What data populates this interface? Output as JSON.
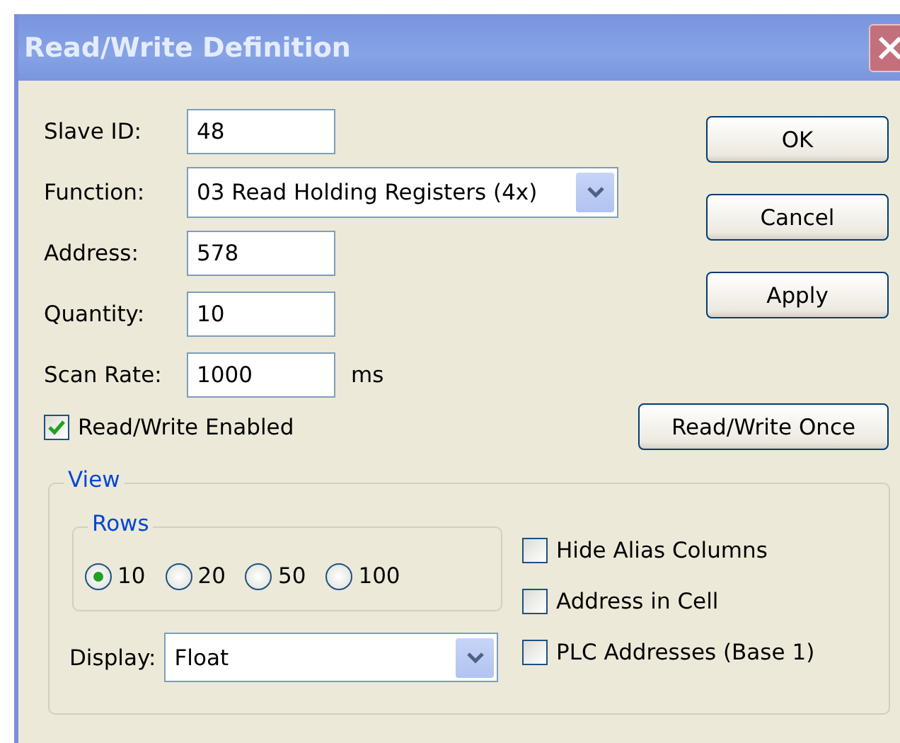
{
  "window": {
    "title": "Read/Write Definition"
  },
  "fields": [
    {
      "label": "Slave ID:",
      "kind": "text",
      "value": "48"
    },
    {
      "label": "Function:",
      "kind": "select",
      "value": "03 Read Holding Registers (4x)"
    },
    {
      "label": "Address:",
      "kind": "text",
      "value": "578"
    },
    {
      "label": "Quantity:",
      "kind": "text",
      "value": "10"
    },
    {
      "label": "Scan Rate:",
      "kind": "text",
      "value": "1000",
      "unit": "ms"
    }
  ],
  "buttons": [
    "OK",
    "Cancel",
    "Apply"
  ],
  "read_write_enabled": {
    "label": "Read/Write Enabled",
    "checked": true
  },
  "read_write_once_button": "Read/Write Once",
  "view": {
    "title": "View",
    "rows": {
      "title": "Rows",
      "options": [
        {
          "label": "10",
          "selected": true
        },
        {
          "label": "20",
          "selected": false
        },
        {
          "label": "50",
          "selected": false
        },
        {
          "label": "100",
          "selected": false
        }
      ]
    },
    "display": {
      "label": "Display:",
      "value": "Float"
    },
    "options": [
      {
        "label": "Hide Alias Columns",
        "checked": false
      },
      {
        "label": "Address in Cell",
        "checked": false
      },
      {
        "label": "PLC Addresses (Base 1)",
        "checked": false
      }
    ]
  }
}
